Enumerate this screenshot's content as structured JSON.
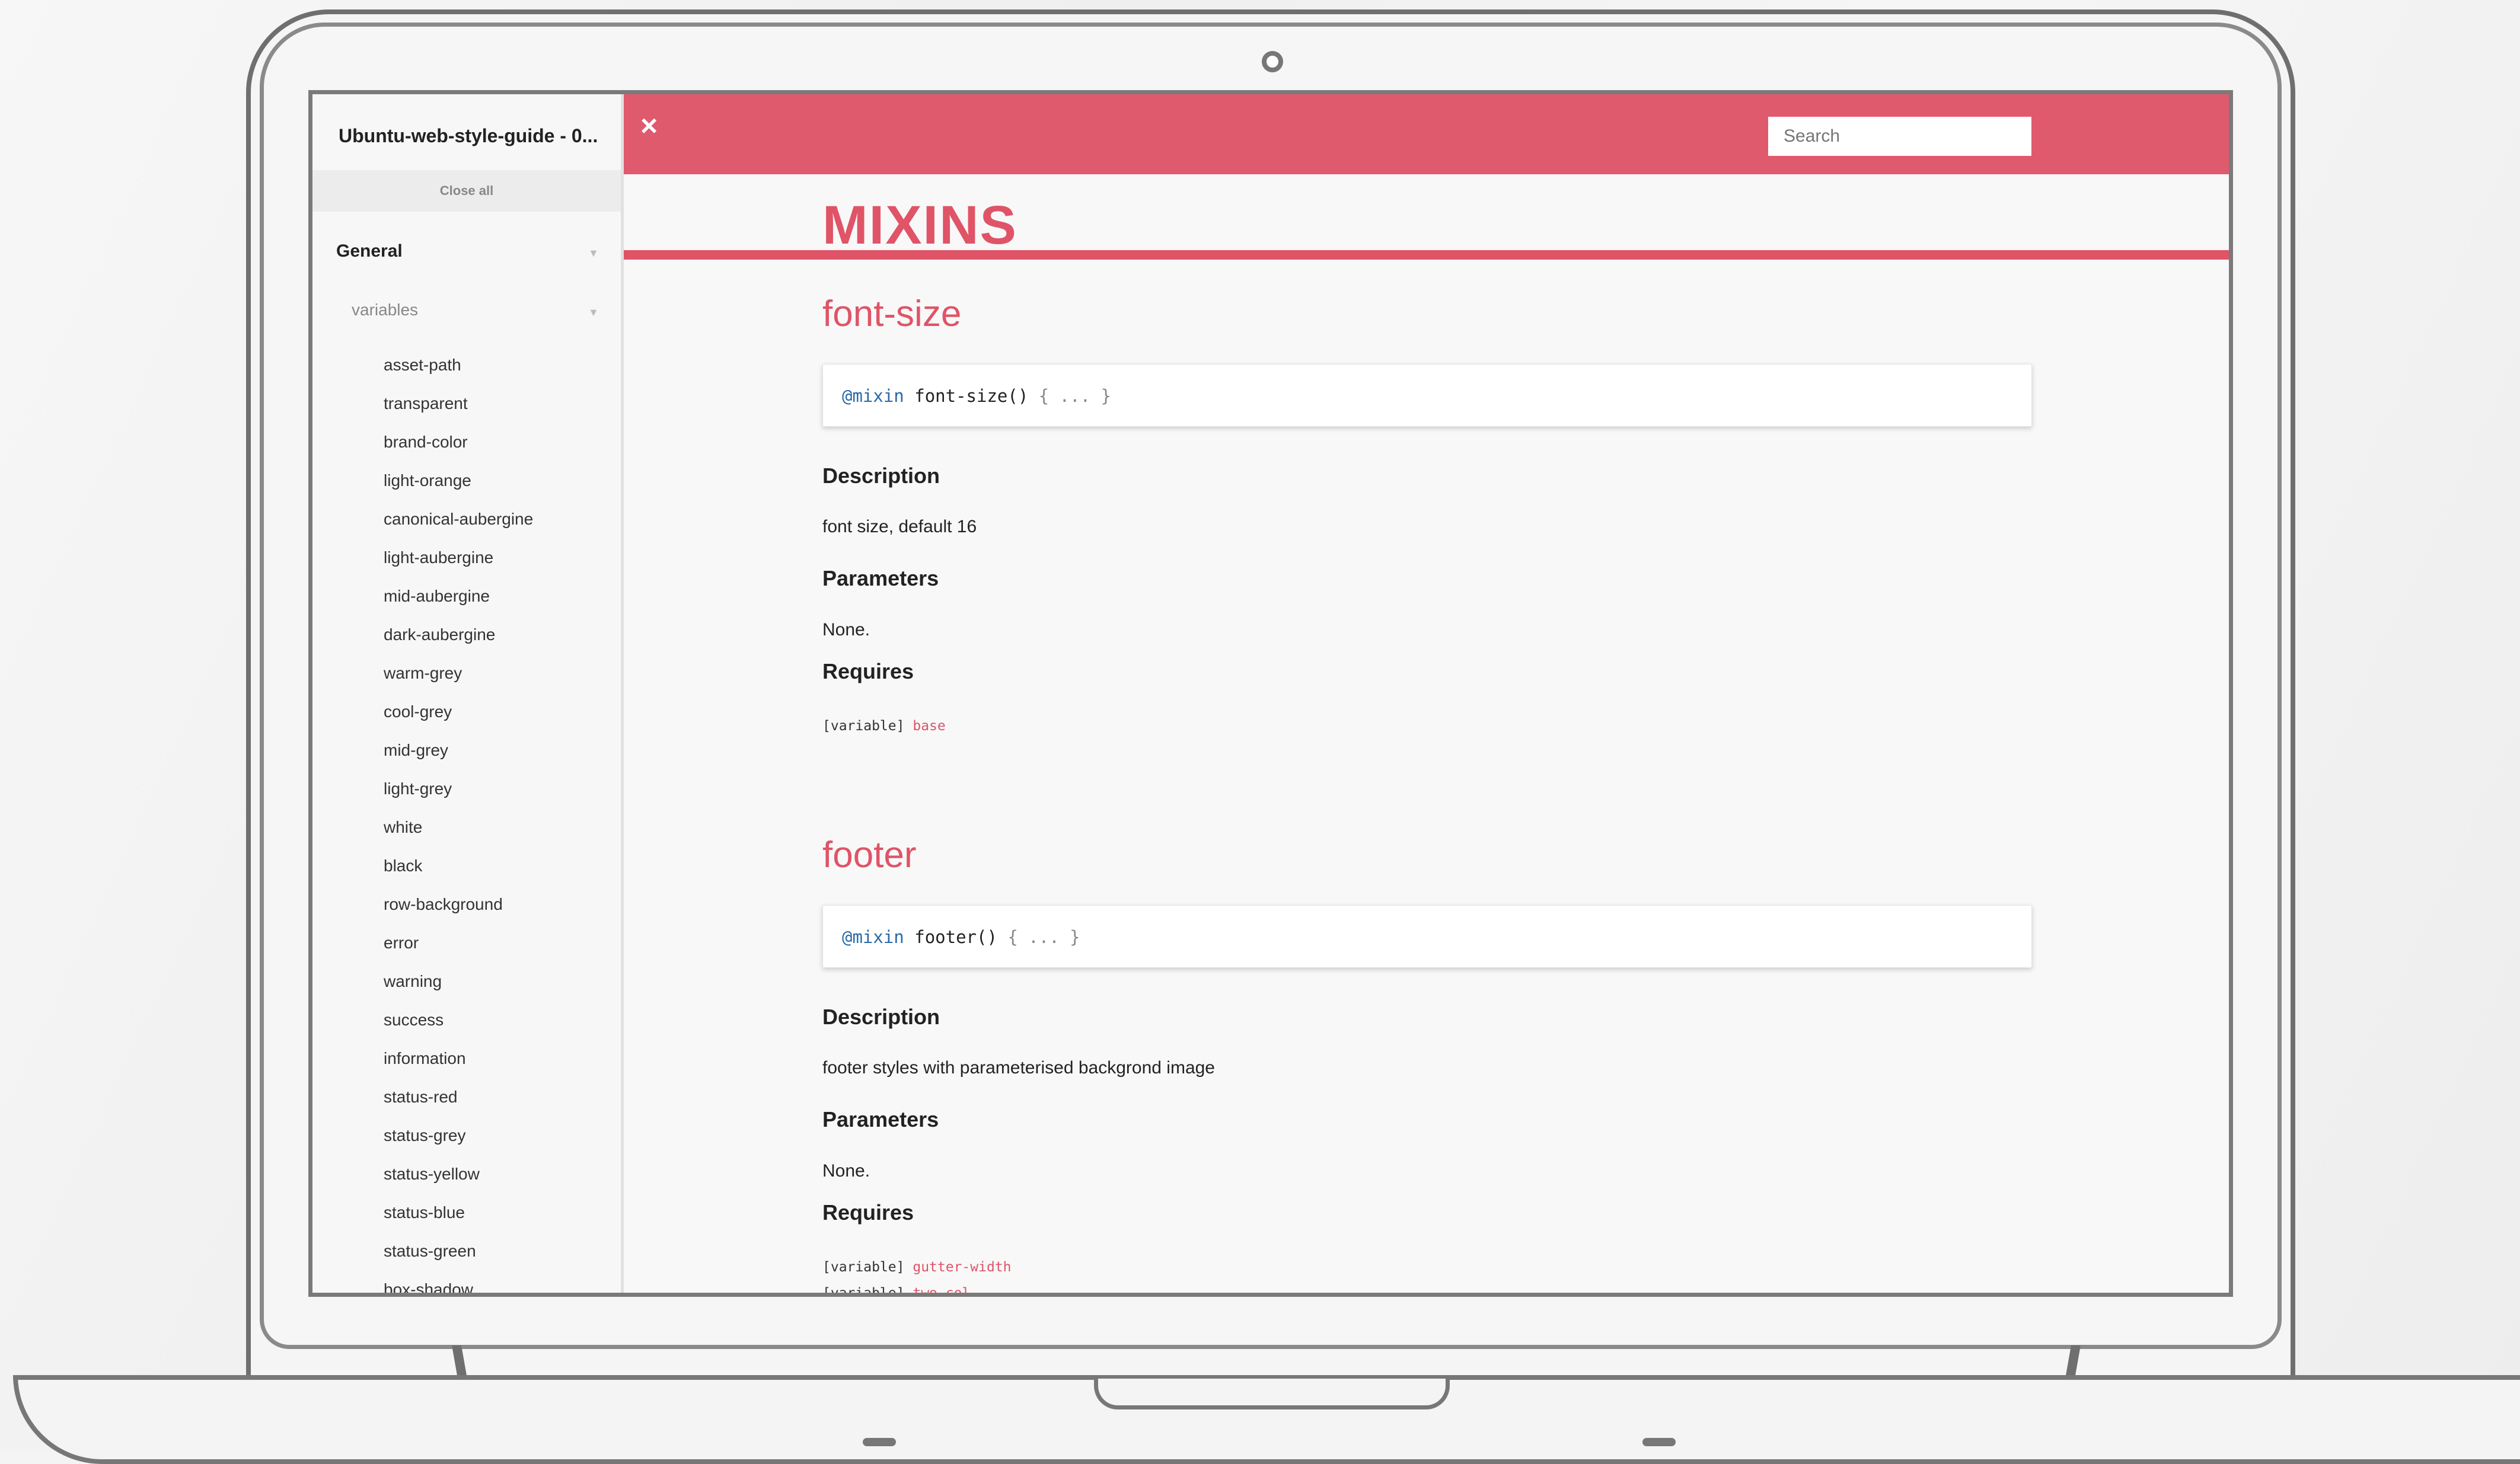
{
  "sidebar": {
    "title": "Ubuntu-web-style-guide - 0...",
    "close_all": "Close all",
    "group": "General",
    "subgroup": "variables",
    "items": [
      "asset-path",
      "transparent",
      "brand-color",
      "light-orange",
      "canonical-aubergine",
      "light-aubergine",
      "mid-aubergine",
      "dark-aubergine",
      "warm-grey",
      "cool-grey",
      "mid-grey",
      "light-grey",
      "white",
      "black",
      "row-background",
      "error",
      "warning",
      "success",
      "information",
      "status-red",
      "status-grey",
      "status-yellow",
      "status-blue",
      "status-green",
      "box-shadow"
    ]
  },
  "topbar": {
    "close_symbol": "×",
    "search_placeholder": "Search"
  },
  "main": {
    "page_title": "MIXINS",
    "mixins": [
      {
        "name": "font-size",
        "code_keyword": "@mixin",
        "code_signature": "font-size()",
        "code_body": "{ ... }",
        "description_heading": "Description",
        "description": "font size, default 16",
        "parameters_heading": "Parameters",
        "parameters": "None.",
        "requires_heading": "Requires",
        "requires": [
          {
            "type": "[variable]",
            "name": "base"
          }
        ]
      },
      {
        "name": "footer",
        "code_keyword": "@mixin",
        "code_signature": "footer()",
        "code_body": "{ ... }",
        "description_heading": "Description",
        "description": "footer styles with parameterised backgrond image",
        "parameters_heading": "Parameters",
        "parameters": "None.",
        "requires_heading": "Requires",
        "requires": [
          {
            "type": "[variable]",
            "name": "gutter-width"
          },
          {
            "type": "[variable]",
            "name": "two-col"
          }
        ]
      }
    ]
  },
  "colors": {
    "accent": "#e05a6e",
    "keyword": "#2a6aa8"
  }
}
